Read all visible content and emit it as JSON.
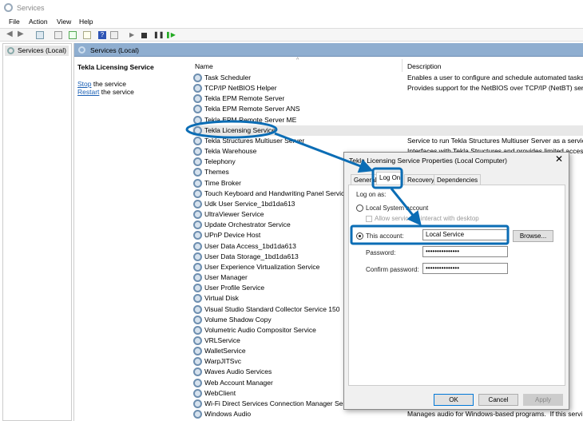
{
  "window": {
    "title": "Services"
  },
  "menu": [
    "File",
    "Action",
    "View",
    "Help"
  ],
  "tree": {
    "item": "Services (Local)"
  },
  "main": {
    "header": "Services (Local)",
    "selected_service": "Tekla Licensing Service",
    "stop_link": "Stop",
    "stop_text": " the service",
    "restart_link": "Restart",
    "restart_text": " the service"
  },
  "columns": {
    "name": "Name",
    "description": "Description"
  },
  "services": [
    {
      "name": "Task Scheduler",
      "desc": "Enables a user to configure and schedule automated tasks"
    },
    {
      "name": "TCP/IP NetBIOS Helper",
      "desc": "Provides support for the NetBIOS over TCP/IP (NetBT) servi"
    },
    {
      "name": "Tekla EPM Remote Server",
      "desc": ""
    },
    {
      "name": "Tekla EPM Remote Server ANS",
      "desc": ""
    },
    {
      "name": "Tekla EPM Remote Server ME",
      "desc": ""
    },
    {
      "name": "Tekla Licensing Service",
      "desc": ""
    },
    {
      "name": "Tekla Structures Multiuser Server",
      "desc": "Service to run Tekla Structures Multiuser Server as a service"
    },
    {
      "name": "Tekla Warehouse",
      "desc": "Interfaces with Tekla Structures and provides limited access"
    },
    {
      "name": "Telephony",
      "desc": "                                                                      t c"
    },
    {
      "name": "Themes",
      "desc": ""
    },
    {
      "name": "Time Broker",
      "desc": "                                                                      ppl"
    },
    {
      "name": "Touch Keyboard and Handwriting Panel Service",
      "desc": "                                                                      d ir"
    },
    {
      "name": "Udk User Service_1bd1da613",
      "desc": ""
    },
    {
      "name": "UltraViewer Service",
      "desc": ""
    },
    {
      "name": "Update Orchestrator Service",
      "desc": "                                                                      ll n"
    },
    {
      "name": "UPnP Device Host",
      "desc": "                                                                      this"
    },
    {
      "name": "User Data Access_1bd1da613",
      "desc": "                                                                      cor"
    },
    {
      "name": "User Data Storage_1bd1da613",
      "desc": "                                                                      act"
    },
    {
      "name": "User Experience Virtualization Service",
      "desc": "                                                                      ng"
    },
    {
      "name": "User Manager",
      "desc": "                                                                      ed f"
    },
    {
      "name": "User Profile Service",
      "desc": "                                                                      er p"
    },
    {
      "name": "Virtual Disk",
      "desc": "                                                                      yst"
    },
    {
      "name": "Visual Studio Standard Collector Service 150",
      "desc": "                                                                      is s"
    },
    {
      "name": "Volume Shadow Copy",
      "desc": "                                                                      l for"
    },
    {
      "name": "Volumetric Audio Compositor Service",
      "desc": "                                                                      n."
    },
    {
      "name": "VRLService",
      "desc": ""
    },
    {
      "name": "WalletService",
      "desc": ""
    },
    {
      "name": "WarpJITSvc",
      "desc": "                                                                      nir"
    },
    {
      "name": "Waves Audio Services",
      "desc": ""
    },
    {
      "name": "Web Account Manager",
      "desc": "                                                                      e si"
    },
    {
      "name": "WebClient",
      "desc": "                                                                      d m"
    },
    {
      "name": "Wi-Fi Direct Services Connection Manager Service",
      "desc": "                                                                      rele"
    },
    {
      "name": "Windows Audio",
      "desc": "Manages audio for Windows-based programs.  If this servi"
    }
  ],
  "dialog": {
    "title": "Tekla Licensing Service Properties (Local Computer)",
    "tabs": [
      "General",
      "Log On",
      "Recovery",
      "Dependencies"
    ],
    "log_on_as": "Log on as:",
    "local_system": "Local System account",
    "allow_interact": "Allow service to interact with desktop",
    "this_account": "This account:",
    "account_value": "Local Service",
    "browse": "Browse...",
    "password_label": "Password:",
    "password_value": "•••••••••••••••",
    "confirm_label": "Confirm password:",
    "confirm_value": "•••••••••••••••",
    "ok": "OK",
    "cancel": "Cancel",
    "apply": "Apply"
  },
  "colors": {
    "annotation": "#0b6db5",
    "header": "#8faed0",
    "link": "#1a5fb4"
  }
}
